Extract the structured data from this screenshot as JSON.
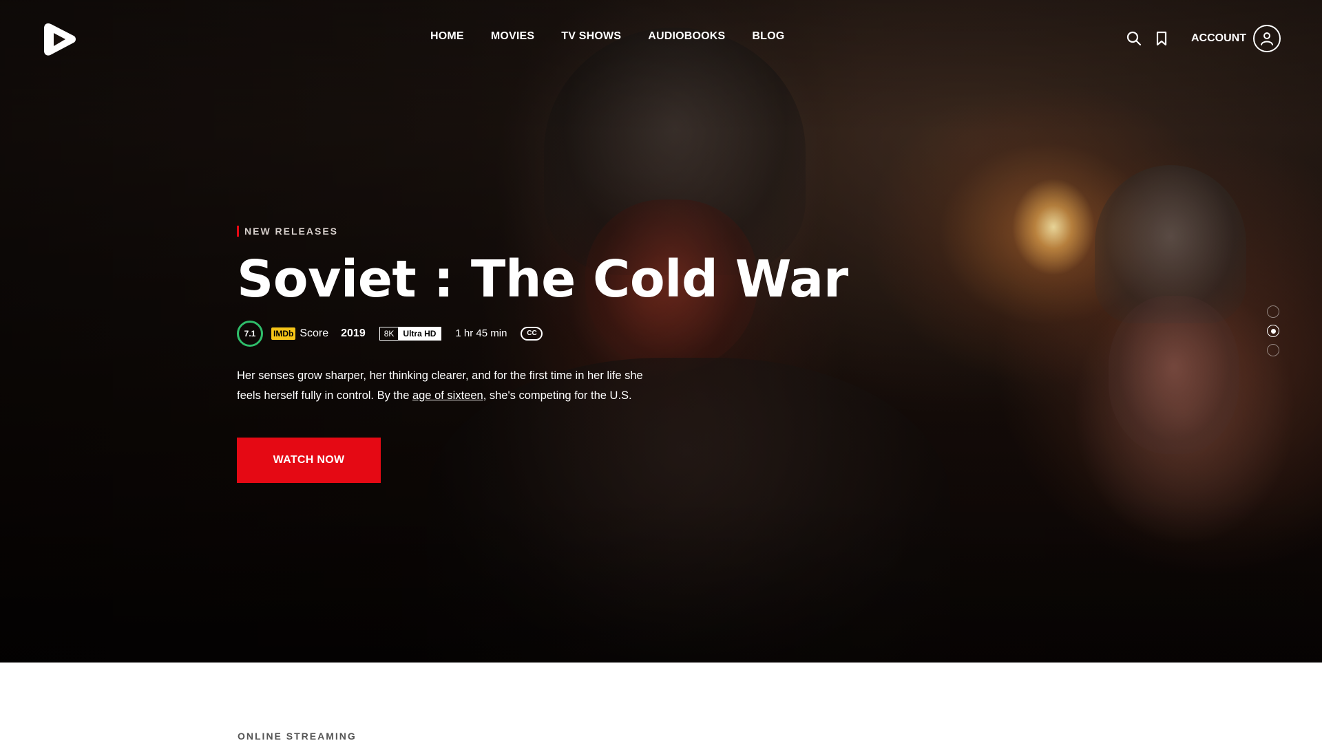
{
  "header": {
    "nav": [
      "HOME",
      "MOVIES",
      "TV SHOWS",
      "AUDIOBOOKS",
      "BLOG"
    ],
    "account_label": "ACCOUNT",
    "icons": [
      "play-logo-icon",
      "search-icon",
      "bookmark-icon",
      "user-icon"
    ]
  },
  "hero": {
    "eyebrow": "NEW RELEASES",
    "title": "Soviet : The Cold War",
    "rating": "7.1",
    "imdb_label": "IMDb",
    "score_label": "Score",
    "year": "2019",
    "quality_res": "8K",
    "quality_label": "Ultra HD",
    "duration": "1 hr 45 min",
    "cc_label": "CC",
    "description_before": "Her senses grow sharper, her thinking clearer, and for the first time in her life she feels herself fully in control. By the ",
    "description_link": "age of sixteen",
    "description_after": ", she's competing for the U.S.",
    "cta": "WATCH NOW",
    "slides_total": 3,
    "active_slide": 2
  },
  "section": {
    "label": "ONLINE STREAMING"
  },
  "colors": {
    "accent": "#e50914",
    "rating_ring": "#2fbd6a",
    "imdb": "#f5c518"
  }
}
